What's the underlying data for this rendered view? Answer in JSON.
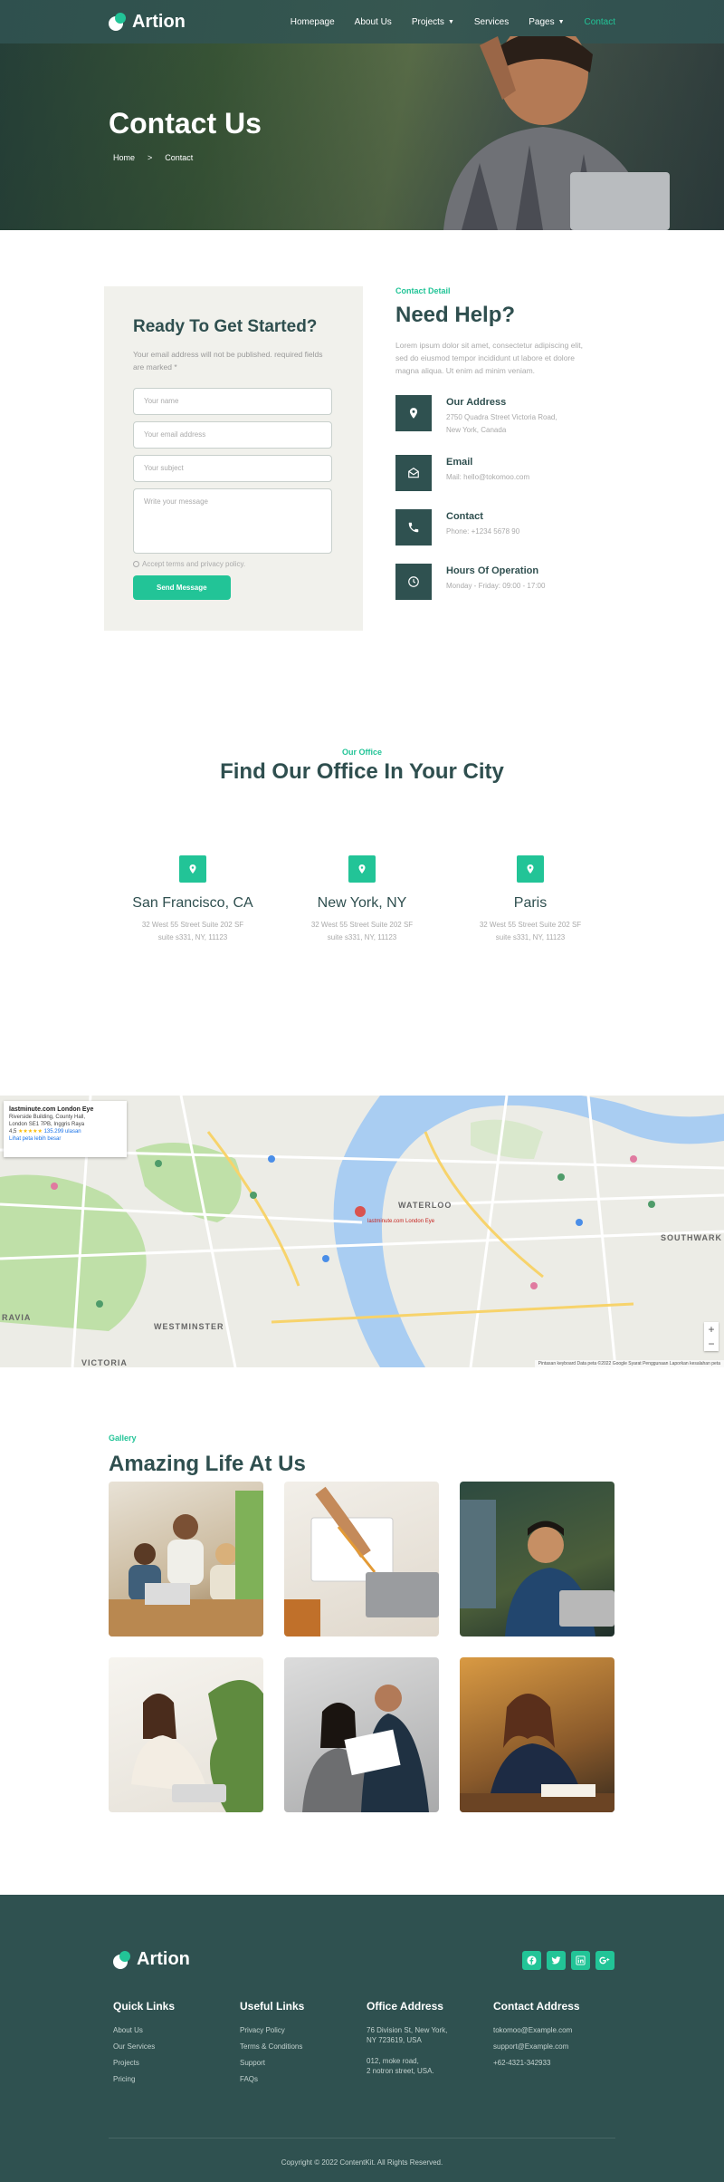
{
  "brand": {
    "name": "Artion",
    "accent": "#22c497",
    "dark": "#2f5150"
  },
  "nav": {
    "items": [
      {
        "label": "Homepage"
      },
      {
        "label": "About Us"
      },
      {
        "label": "Projects"
      },
      {
        "label": "Services"
      },
      {
        "label": "Pages"
      },
      {
        "label": "Contact"
      }
    ]
  },
  "hero": {
    "title": "Contact Us",
    "breadcrumb": {
      "home": "Home",
      "sep": ">",
      "current": "Contact"
    }
  },
  "form": {
    "title": "Ready To Get Started?",
    "note": "Your email address will not be published. required fields are marked *",
    "name_placeholder": "Your name",
    "email_placeholder": "Your email address",
    "subject_placeholder": "Your subject",
    "message_placeholder": "Write your message",
    "terms": "Accept terms and privacy policy.",
    "submit": "Send Message"
  },
  "help": {
    "eyebrow": "Contact Detail",
    "title": "Need Help?",
    "lead": "Lorem ipsum dolor sit amet, consectetur adipiscing elit, sed do eiusmod tempor incididunt ut labore et dolore magna aliqua. Ut enim ad minim veniam.",
    "items": [
      {
        "title": "Our Address",
        "lines": [
          "2750 Quadra Street Victoria Road,",
          "New York, Canada"
        ],
        "icon": "map-pin-icon"
      },
      {
        "title": "Email",
        "lines": [
          "Mail: hello@tokomoo.com"
        ],
        "icon": "envelope-icon"
      },
      {
        "title": "Contact",
        "lines": [
          "Phone: +1234 5678 90"
        ],
        "icon": "phone-icon"
      },
      {
        "title": "Hours Of Operation",
        "lines": [
          "Monday - Friday: 09:00 - 17:00"
        ],
        "icon": "clock-icon"
      }
    ]
  },
  "offices": {
    "eyebrow": "Our Office",
    "title": "Find Our Office In Your City",
    "cities": [
      {
        "name": "San Francisco, CA",
        "line1": "32 West 55 Street Suite 202 SF",
        "line2": "suite s331, NY, 11123"
      },
      {
        "name": "New York, NY",
        "line1": "32 West 55 Street Suite 202 SF",
        "line2": "suite s331, NY, 11123"
      },
      {
        "name": "Paris",
        "line1": "32 West 55 Street Suite 202 SF",
        "line2": "suite s331, NY, 11123"
      }
    ]
  },
  "map": {
    "card_title": "lastminute.com London Eye",
    "card_addr1": "Riverside Building, County Hall,",
    "card_addr2": "London SE1 7PB, Inggris Raya",
    "rating": "4,5",
    "stars": "★★★★★",
    "reviews": "135.299 ulasan",
    "card_link": "Lihat peta lebih besar",
    "pin_label": "lastminute.com London Eye",
    "labels": {
      "waterloo": "WATERLOO",
      "westminster": "WESTMINSTER",
      "victoria": "VICTORIA",
      "southwark": "SOUTHWARK",
      "ravia": "RAVIA"
    },
    "zoom_in": "+",
    "zoom_out": "−",
    "attribution": "Pintasan keyboard   Data peta ©2022 Google   Syarat Penggunaan   Laporkan kesalahan peta"
  },
  "gallery": {
    "eyebrow": "Gallery",
    "title": "Amazing Life At Us"
  },
  "footer": {
    "quick": {
      "title": "Quick Links",
      "items": [
        "About Us",
        "Our Services",
        "Projects",
        "Pricing"
      ]
    },
    "useful": {
      "title": "Useful Links",
      "items": [
        "Privacy Policy",
        "Terms & Conditions",
        "Support",
        "FAQs"
      ]
    },
    "office": {
      "title": "Office Address",
      "lines": [
        "76 Division St, New York,",
        "NY 723619, USA",
        "012, moke road,",
        "2 notron street, USA."
      ]
    },
    "contact": {
      "title": "Contact Address",
      "items": [
        "tokomoo@Example.com",
        "support@Example.com",
        "+62-4321-342933"
      ]
    },
    "socials": [
      "facebook-icon",
      "twitter-icon",
      "linkedin-icon",
      "google-plus-icon"
    ],
    "social_labels": [
      "f",
      "t",
      "in",
      "G+"
    ],
    "copyright": "Copyright © 2022 ContentKit. All Rights Reserved."
  }
}
